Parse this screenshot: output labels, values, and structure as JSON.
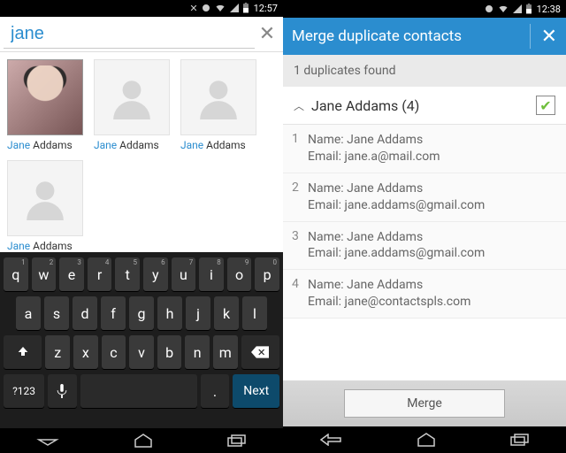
{
  "left": {
    "status_time": "12:57",
    "search_value": "jane",
    "contacts": [
      {
        "first": "Jane",
        "last": "Addams",
        "photo": true
      },
      {
        "first": "Jane",
        "last": "Addams",
        "photo": false
      },
      {
        "first": "Jane",
        "last": "Addams",
        "photo": false
      },
      {
        "first": "Jane",
        "last": "Addams",
        "photo": false
      }
    ],
    "keyboard": {
      "row1": [
        "q",
        "w",
        "e",
        "r",
        "t",
        "y",
        "u",
        "i",
        "o",
        "p"
      ],
      "row1_alt": [
        "1",
        "2",
        "3",
        "4",
        "5",
        "6",
        "7",
        "8",
        "9",
        "0"
      ],
      "row2": [
        "a",
        "s",
        "d",
        "f",
        "g",
        "h",
        "j",
        "k",
        "l"
      ],
      "row3": [
        "z",
        "x",
        "c",
        "v",
        "b",
        "n",
        "m"
      ],
      "sym": "?123",
      "next": "Next",
      "period": "."
    }
  },
  "right": {
    "status_time": "12:38",
    "title": "Merge duplicate contacts",
    "subtitle": "1 duplicates found",
    "group_name": "Jane Addams (4)",
    "checked": true,
    "name_label": "Name:",
    "email_label": "Email:",
    "items": [
      {
        "idx": "1",
        "name": "Jane Addams",
        "email": "jane.a@mail.com"
      },
      {
        "idx": "2",
        "name": "Jane Addams",
        "email": "jane.addams@gmail.com"
      },
      {
        "idx": "3",
        "name": "Jane Addams",
        "email": "jane.addams@gmail.com"
      },
      {
        "idx": "4",
        "name": "Jane Addams",
        "email": "jane@contactspls.com"
      }
    ],
    "merge_label": "Merge"
  }
}
